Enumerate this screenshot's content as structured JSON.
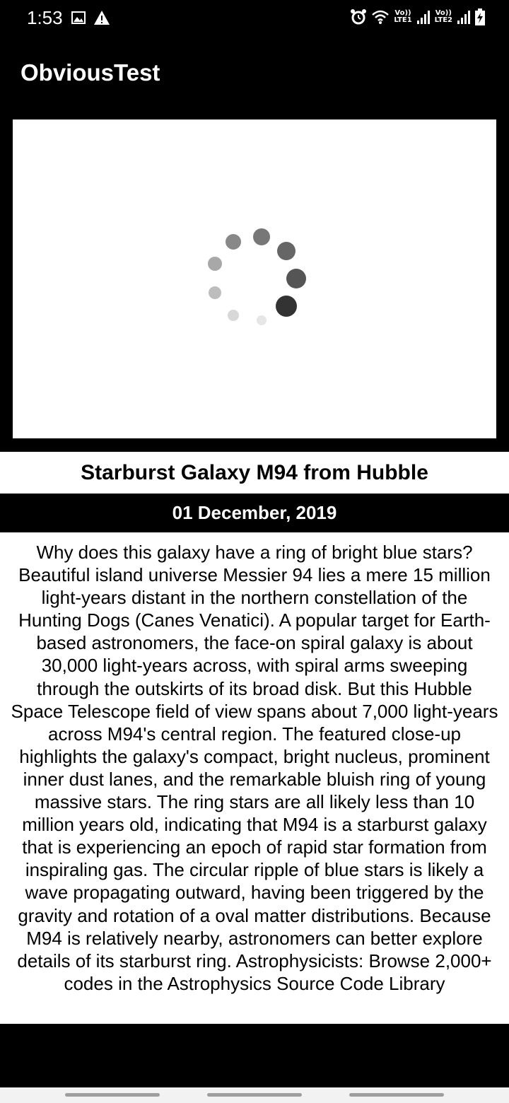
{
  "status_bar": {
    "time": "1:53",
    "left_icons": [
      "image-icon",
      "warning-icon"
    ],
    "right_icons": [
      "alarm-icon",
      "wifi-icon",
      "signal-lte1-icon",
      "signal-lte2-icon",
      "battery-charging-icon"
    ],
    "sim1_label_top": "Vo))",
    "sim1_label_bottom": "LTE1",
    "sim2_label_top": "Vo))",
    "sim2_label_bottom": "LTE2"
  },
  "app_bar": {
    "title": "ObviousTest"
  },
  "image_panel": {
    "state": "loading",
    "spinner_icon": "loading-spinner-icon"
  },
  "article": {
    "title": "Starburst Galaxy M94 from Hubble",
    "date": "01 December, 2019",
    "description": "Why does this galaxy have a ring of bright blue stars? Beautiful island universe Messier 94 lies a mere 15 million light-years distant in the northern constellation of the Hunting Dogs (Canes Venatici). A popular target for Earth-based astronomers, the face-on spiral galaxy is about 30,000 light-years across, with spiral arms sweeping through the outskirts of its broad disk. But this Hubble Space Telescope field of view spans about 7,000 light-years across M94's central region. The featured close-up highlights the galaxy's compact, bright nucleus, prominent inner dust lanes, and the remarkable bluish ring of young massive stars. The ring stars are all likely less than 10 million years old, indicating that M94 is a starburst galaxy that is experiencing an epoch of rapid star formation from inspiraling gas. The circular ripple of blue stars is likely a wave propagating outward, having been triggered by the gravity and rotation of a oval matter distributions. Because M94 is relatively nearby, astronomers can better explore details of its starburst ring.    Astrophysicists: Browse 2,000+ codes in the Astrophysics Source Code Library"
  },
  "colors": {
    "background": "#000000",
    "surface": "#ffffff",
    "text_primary": "#000000",
    "text_on_dark": "#ffffff"
  }
}
